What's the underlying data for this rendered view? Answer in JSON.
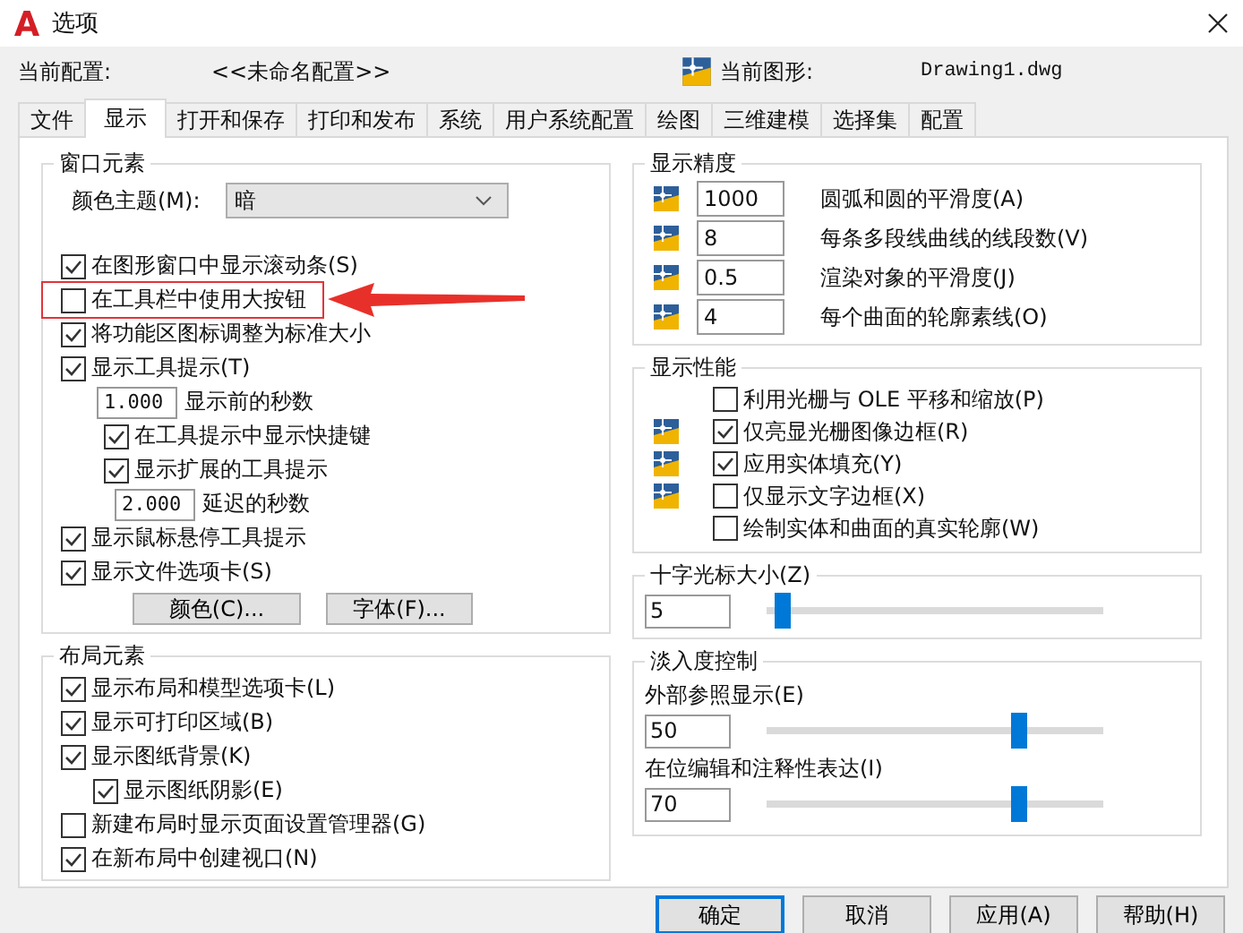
{
  "window": {
    "title": "选项"
  },
  "profile": {
    "label": "当前配置:",
    "value": "<<未命名配置>>",
    "drawing_label": "当前图形:",
    "drawing_value": "Drawing1.dwg"
  },
  "tabs": [
    {
      "label": "文件",
      "selected": false
    },
    {
      "label": "显示",
      "selected": true
    },
    {
      "label": "打开和保存",
      "selected": false
    },
    {
      "label": "打印和发布",
      "selected": false
    },
    {
      "label": "系统",
      "selected": false
    },
    {
      "label": "用户系统配置",
      "selected": false
    },
    {
      "label": "绘图",
      "selected": false
    },
    {
      "label": "三维建模",
      "selected": false
    },
    {
      "label": "选择集",
      "selected": false
    },
    {
      "label": "配置",
      "selected": false
    }
  ],
  "window_elements": {
    "title": "窗口元素",
    "color_theme": {
      "label": "颜色主题(M):",
      "value": "暗"
    },
    "items": [
      {
        "kind": "check",
        "label": "在图形窗口中显示滚动条(S)",
        "checked": true,
        "highlighted": false
      },
      {
        "kind": "check",
        "label": "在工具栏中使用大按钮",
        "checked": false,
        "highlighted": true
      },
      {
        "kind": "check",
        "label": "将功能区图标调整为标准大小",
        "checked": true,
        "highlighted": false
      },
      {
        "kind": "check",
        "label": "显示工具提示(T)",
        "checked": true,
        "highlighted": false,
        "children": [
          {
            "kind": "number",
            "value": "1.000",
            "label": "显示前的秒数"
          },
          {
            "kind": "check",
            "label": "在工具提示中显示快捷键",
            "checked": true
          },
          {
            "kind": "check",
            "label": "显示扩展的工具提示",
            "checked": true,
            "children": [
              {
                "kind": "number",
                "value": "2.000",
                "label": "延迟的秒数"
              }
            ]
          }
        ]
      },
      {
        "kind": "check",
        "label": "显示鼠标悬停工具提示",
        "checked": true,
        "highlighted": false
      },
      {
        "kind": "check",
        "label": "显示文件选项卡(S)",
        "checked": true,
        "highlighted": false
      }
    ],
    "buttons": [
      "颜色(C)...",
      "字体(F)..."
    ]
  },
  "layout_elements": {
    "title": "布局元素",
    "items": [
      {
        "label": "显示布局和模型选项卡(L)",
        "checked": true
      },
      {
        "label": "显示可打印区域(B)",
        "checked": true
      },
      {
        "label": "显示图纸背景(K)",
        "checked": true,
        "children": [
          {
            "label": "显示图纸阴影(E)",
            "checked": true
          }
        ]
      },
      {
        "label": "新建布局时显示页面设置管理器(G)",
        "checked": false
      },
      {
        "label": "在新布局中创建视口(N)",
        "checked": true
      }
    ]
  },
  "display_resolution": {
    "title": "显示精度",
    "rows": [
      {
        "value": "1000",
        "label": "圆弧和圆的平滑度(A)"
      },
      {
        "value": "8",
        "label": "每条多段线曲线的线段数(V)"
      },
      {
        "value": "0.5",
        "label": "渲染对象的平滑度(J)"
      },
      {
        "value": "4",
        "label": "每个曲面的轮廓素线(O)"
      }
    ]
  },
  "display_performance": {
    "title": "显示性能",
    "items": [
      {
        "label": "利用光栅与 OLE 平移和缩放(P)",
        "checked": false,
        "drawing_icon": false
      },
      {
        "label": "仅亮显光栅图像边框(R)",
        "checked": true,
        "drawing_icon": true
      },
      {
        "label": "应用实体填充(Y)",
        "checked": true,
        "drawing_icon": true
      },
      {
        "label": "仅显示文字边框(X)",
        "checked": false,
        "drawing_icon": true
      },
      {
        "label": "绘制实体和曲面的真实轮廓(W)",
        "checked": false,
        "drawing_icon": false
      }
    ]
  },
  "crosshair": {
    "title": "十字光标大小(Z)",
    "value": "5",
    "level": 0.05
  },
  "fade_control": {
    "title": "淡入度控制",
    "items": [
      {
        "label": "外部参照显示(E)",
        "value": "50",
        "level": 0.75
      },
      {
        "label": "在位编辑和注释性表达(I)",
        "value": "70",
        "level": 0.75
      }
    ]
  },
  "buttons": [
    {
      "label": "确定",
      "default": true
    },
    {
      "label": "取消",
      "default": false
    },
    {
      "label": "应用(A)",
      "default": false
    },
    {
      "label": "帮助(H)",
      "default": false
    }
  ]
}
